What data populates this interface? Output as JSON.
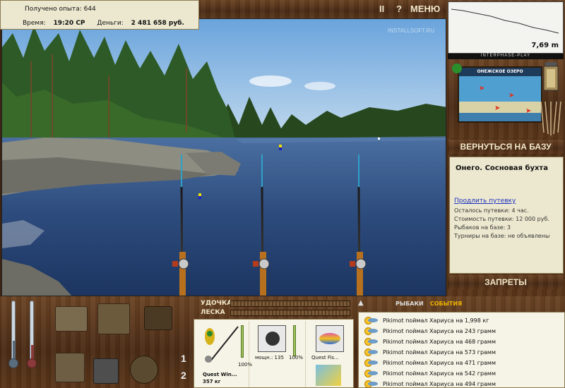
{
  "info": {
    "experience": "Получено опыта: 644",
    "time_label": "Время:",
    "time_value": "19:20 СР",
    "money_label": "Деньги:",
    "money_value": "2 481 658 руб."
  },
  "topbar": {
    "pause": "II",
    "help": "?",
    "menu": "МЕНЮ"
  },
  "scene": {
    "watermark": "INSTALLSOFT.RU"
  },
  "sonar": {
    "depth": "7,69 m"
  },
  "brand": "INTERPHASE-PLAY",
  "map": {
    "title": "ОНЕЖСКОЕ ОЗЕРО"
  },
  "buttons": {
    "back_to_base": "ВЕРНУТЬСЯ НА БАЗУ",
    "bans": "ЗАПРЕТЫ"
  },
  "location": {
    "title": "Онего. Сосновая бухта",
    "extend_link": "Продлить путевку",
    "lines": [
      "Осталось путевки: 4 час.",
      "Стоимость путевки: 12 000 руб.",
      "Рыбаков на базе: 3",
      "Турниры на базе: не объявлены"
    ]
  },
  "meters": {
    "rod_label": "УДОЧКА",
    "line_label": "ЛЕСКА"
  },
  "slots": [
    "1",
    "2"
  ],
  "tackle": {
    "rod_percent": "100%",
    "rod_name": "Quest Win...",
    "rod_weight": "357 кг",
    "reel_power": "мощн.: 135",
    "reel_percent": "100%",
    "line_name": "Quest Fis..."
  },
  "tabs": {
    "fishers": "РЫБАКИ",
    "events": "СОБЫТИЯ"
  },
  "events": [
    "Pikimot поймал Хариуса на 1,998 кг",
    "Pikimot поймал Хариуса на 243 грамм",
    "Pikimot поймал Хариуса на 468 грамм",
    "Pikimot поймал Хариуса на 573 грамм",
    "Pikimot поймал Хариуса на 471 грамм",
    "Pikimot поймал Хариуса на 542 грамм",
    "Pikimot поймал Хариуса на 494 грамм"
  ],
  "colors": {
    "wood": "#5a3619",
    "panel": "#ece8cf",
    "accent_events": "#f0b400",
    "link": "#1a2ec0"
  }
}
